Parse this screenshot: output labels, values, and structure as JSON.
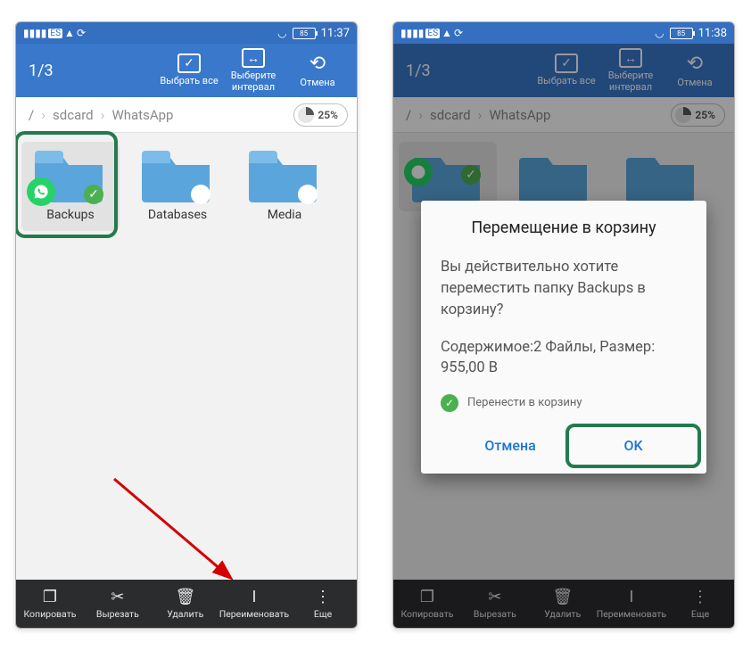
{
  "left": {
    "status": {
      "battery": "85",
      "time": "11:37"
    },
    "toolbar": {
      "counter": "1/3",
      "select_all": "Выбрать все",
      "interval": "Выберите интервал",
      "cancel": "Отмена"
    },
    "breadcrumb": {
      "root": "/",
      "a": "sdcard",
      "b": "WhatsApp",
      "storage": "25%"
    },
    "folders": [
      {
        "name": "Backups"
      },
      {
        "name": "Databases"
      },
      {
        "name": "Media"
      }
    ],
    "bottom": {
      "copy": "Копировать",
      "cut": "Вырезать",
      "delete": "Удалить",
      "rename": "Переименовать",
      "more": "Еще"
    }
  },
  "right": {
    "status": {
      "battery": "85",
      "time": "11:38"
    },
    "toolbar": {
      "counter": "1/3",
      "select_all": "Выбрать все",
      "interval": "Выберите интервал",
      "cancel": "Отмена"
    },
    "breadcrumb": {
      "root": "/",
      "a": "sdcard",
      "b": "WhatsApp",
      "storage": "25%"
    },
    "bottom": {
      "copy": "Копировать",
      "cut": "Вырезать",
      "delete": "Удалить",
      "rename": "Переименовать",
      "more": "Еще"
    },
    "dialog": {
      "title": "Перемещение в корзину",
      "body": "Вы действительно хотите переместить папку Backups в корзину?",
      "content": "Содержимое:2 Файлы, Размер: 955,00 B",
      "checkbox": "Перенести в корзину",
      "cancel": "Отмена",
      "ok": "OK"
    }
  }
}
